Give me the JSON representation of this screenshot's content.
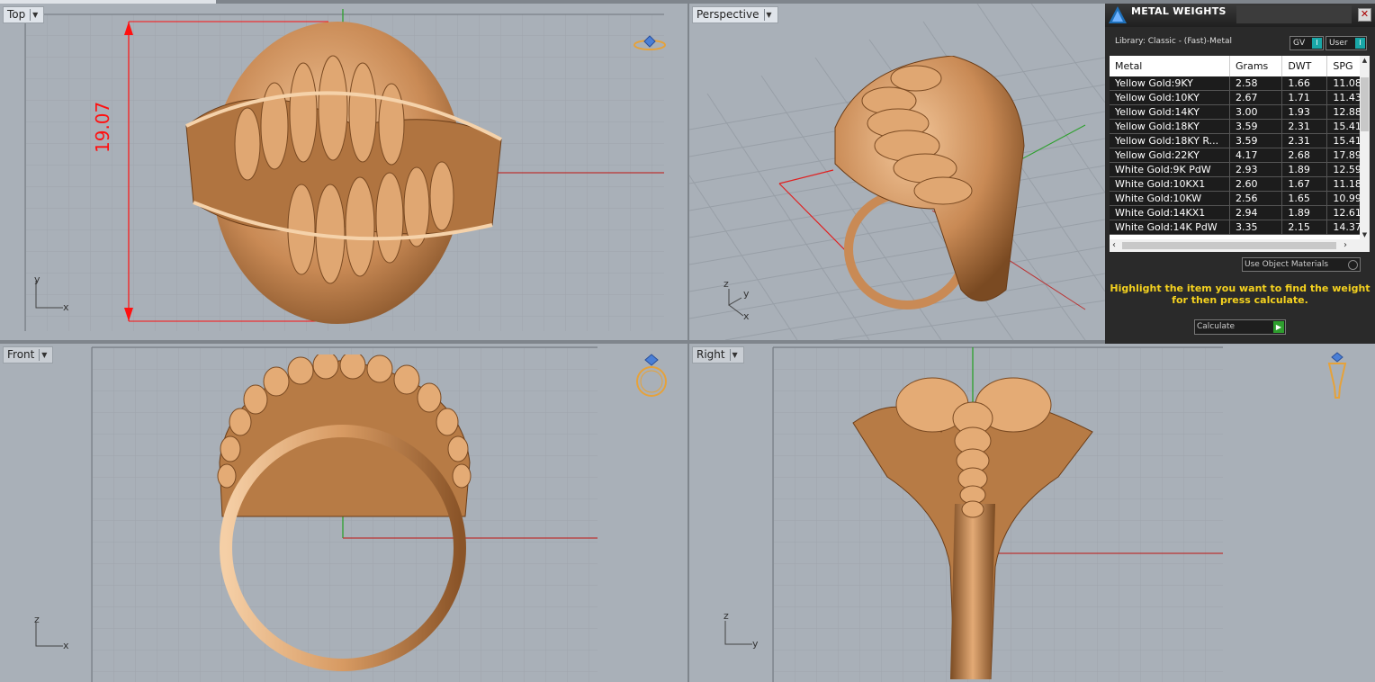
{
  "viewports": {
    "top": {
      "label": "Top",
      "dimension": "19.07",
      "axis_a": "y",
      "axis_b": "x"
    },
    "perspective": {
      "label": "Perspective",
      "axis_z": "z",
      "axis_y": "y",
      "axis_x": "x"
    },
    "front": {
      "label": "Front",
      "axis_a": "z",
      "axis_b": "x"
    },
    "right": {
      "label": "Right",
      "axis_a": "z",
      "axis_b": "y"
    }
  },
  "panel": {
    "title": "METAL WEIGHTS",
    "library": "Library: Classic - (Fast)-Metal",
    "toggle_gv": "GV",
    "toggle_user": "User",
    "toggle_indicator": "I",
    "columns": [
      "Metal",
      "Grams",
      "DWT",
      "SPG"
    ],
    "rows": [
      [
        "Yellow Gold:9KY",
        "2.58",
        "1.66",
        "11.08"
      ],
      [
        "Yellow Gold:10KY",
        "2.67",
        "1.71",
        "11.43"
      ],
      [
        "Yellow Gold:14KY",
        "3.00",
        "1.93",
        "12.88"
      ],
      [
        "Yellow Gold:18KY",
        "3.59",
        "2.31",
        "15.41"
      ],
      [
        "Yellow Gold:18KY R...",
        "3.59",
        "2.31",
        "15.41"
      ],
      [
        "Yellow Gold:22KY",
        "4.17",
        "2.68",
        "17.89"
      ],
      [
        "White Gold:9K PdW",
        "2.93",
        "1.89",
        "12.59"
      ],
      [
        "White Gold:10KX1",
        "2.60",
        "1.67",
        "11.18"
      ],
      [
        "White Gold:10KW",
        "2.56",
        "1.65",
        "10.99"
      ],
      [
        "White Gold:14KX1",
        "2.94",
        "1.89",
        "12.61"
      ],
      [
        "White Gold:14K PdW",
        "3.35",
        "2.15",
        "14.37"
      ]
    ],
    "use_object_materials": "Use Object Materials",
    "hint_line1": "Highlight the item you want to find the weight",
    "hint_line2": "for then press calculate.",
    "calculate": "Calculate"
  },
  "colors": {
    "gold": "#c98a55",
    "dimension": "#ff1010",
    "viewport_bg": "#a9b0b8"
  }
}
